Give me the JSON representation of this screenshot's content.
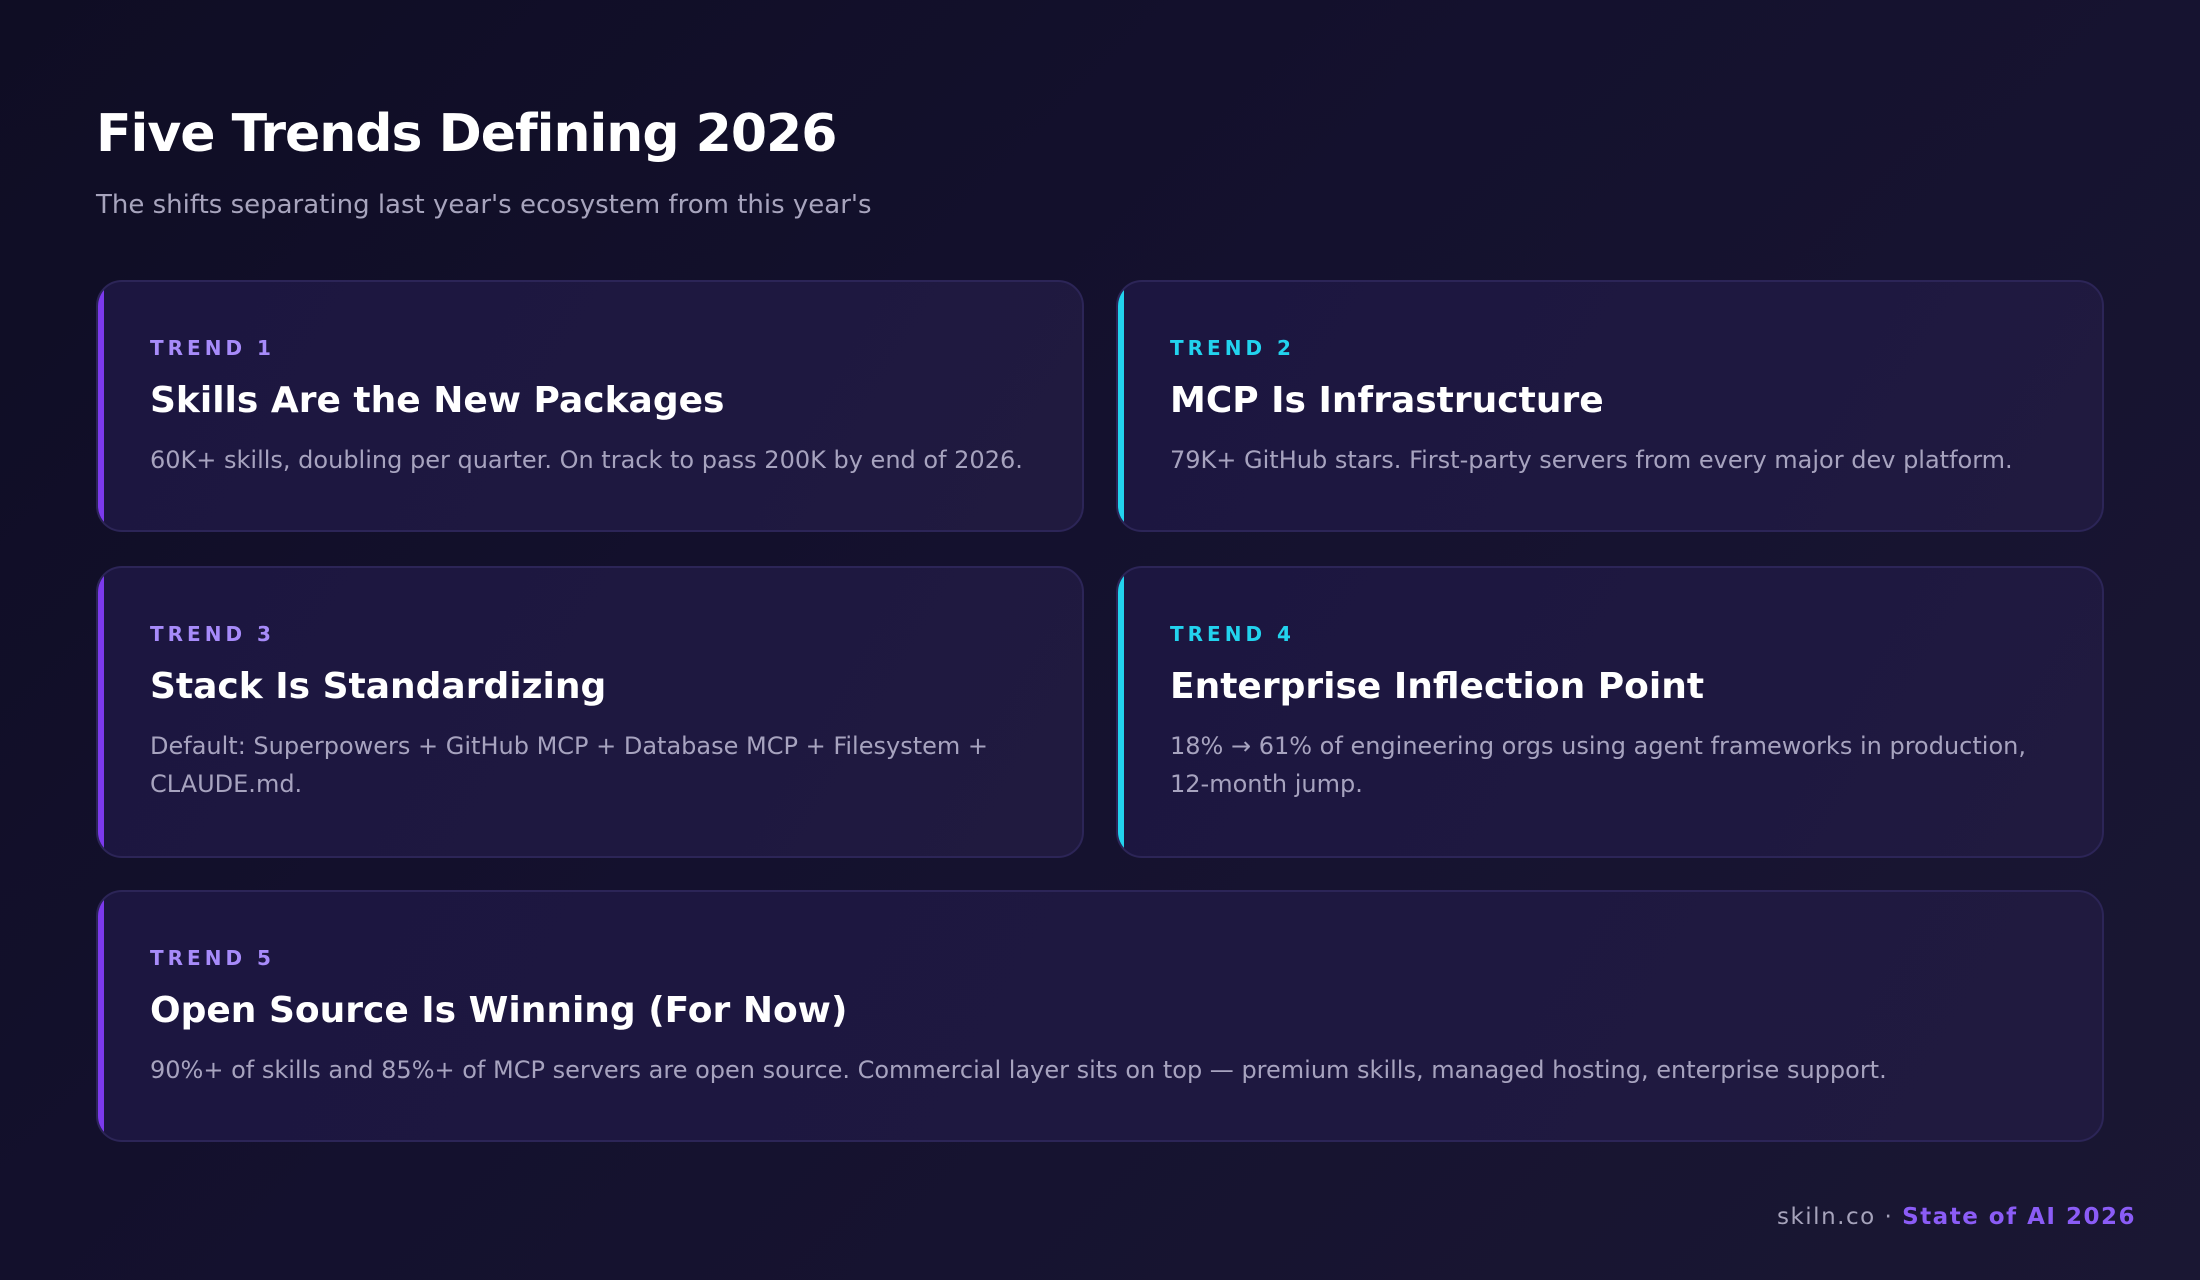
{
  "header": {
    "title": "Five Trends Defining 2026",
    "subtitle": "The shifts separating last year's ecosystem from this year's"
  },
  "colors": {
    "purple_accent": "#7c3aed",
    "purple_label": "#a78bfa",
    "cyan_accent": "#22d3ee",
    "background": "#14112e",
    "card_background": "#1e1840"
  },
  "trends": [
    {
      "label": "TREND 1",
      "title": "Skills Are the New Packages",
      "description": "60K+ skills, doubling per quarter. On track to pass 200K by end of 2026."
    },
    {
      "label": "TREND 2",
      "title": "MCP Is Infrastructure",
      "description": "79K+ GitHub stars. First-party servers from every major dev platform."
    },
    {
      "label": "TREND 3",
      "title": "Stack Is Standardizing",
      "description": "Default: Superpowers + GitHub MCP + Database MCP + Filesystem + CLAUDE.md."
    },
    {
      "label": "TREND 4",
      "title": "Enterprise Inflection Point",
      "description": "18% → 61% of engineering orgs using agent frameworks in production, 12-month jump."
    },
    {
      "label": "TREND 5",
      "title": "Open Source Is Winning (For Now)",
      "description": "90%+ of skills and 85%+ of MCP servers are open source. Commercial layer sits on top — premium skills, managed hosting, enterprise support."
    }
  ],
  "footer": {
    "site": "skiln.co",
    "separator": " · ",
    "brand": "State of AI 2026"
  }
}
